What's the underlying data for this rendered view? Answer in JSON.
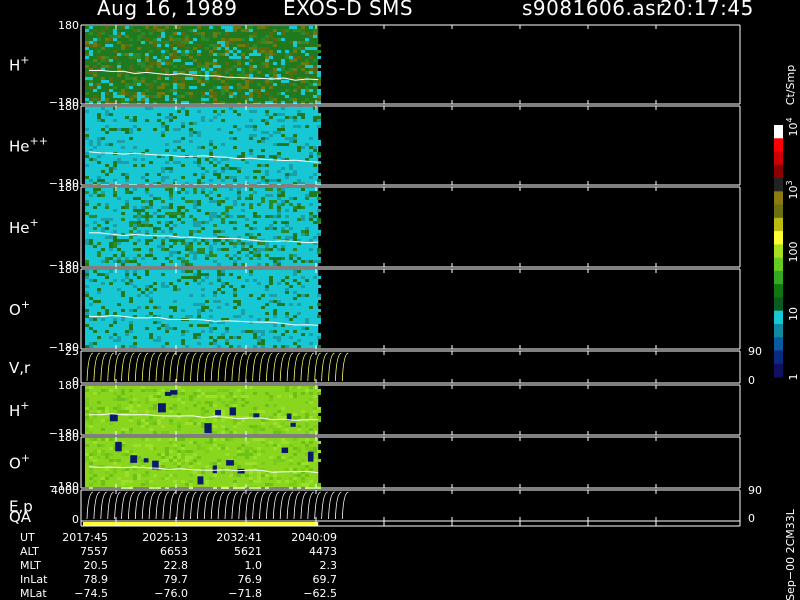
{
  "header": {
    "date": "Aug 16, 1989",
    "mission": "EXOS-D SMS",
    "file": "s9081606.asr",
    "time": "20:17:45"
  },
  "colors": {
    "background": "#000000",
    "axis": "#ffffff",
    "trace": "#ffffff",
    "energy_trace": "#ffff66",
    "qa_bar": "#ffff33",
    "cyan": "#17c8d4",
    "dark_green": "#1f7a1f",
    "olive": "#6d7a12",
    "lime": "#8ad61f",
    "navy": "#0a1a6a"
  },
  "colorbar": {
    "title": "Ct/Smp",
    "scale": "log",
    "range": [
      1,
      10000
    ],
    "tick_labels": [
      {
        "base": "10",
        "exp": "4",
        "value": 10000
      },
      {
        "base": "10",
        "exp": "3",
        "value": 1000
      },
      {
        "base": "100",
        "exp": "",
        "value": 100
      },
      {
        "base": "10",
        "exp": "",
        "value": 10
      },
      {
        "base": "1",
        "exp": "",
        "value": 1
      }
    ],
    "swatches": [
      "#ffffff",
      "#ff0000",
      "#cc0000",
      "#880000",
      "#222222",
      "#8a7a10",
      "#6d7010",
      "#bbbb10",
      "#ffff33",
      "#a8e020",
      "#66cc22",
      "#33aa22",
      "#117711",
      "#0a5a22",
      "#17c8d4",
      "#108aa0",
      "#0a5aa0",
      "#0a2a80",
      "#101060"
    ]
  },
  "panels": [
    {
      "id": "h_plus",
      "label": "H",
      "sup": "+",
      "ymax": "180",
      "ymin": "−180",
      "kind": "spectro",
      "palette": [
        "#1f7a1f",
        "#2a8a2a",
        "#6d7a12",
        "#17c8d4",
        "#5a6a10"
      ]
    },
    {
      "id": "he_pp",
      "label": "He",
      "sup": "++",
      "ymax": "180",
      "ymin": "−180",
      "kind": "spectro",
      "palette": [
        "#17c8d4",
        "#17c8d4",
        "#1aa0a8",
        "#1f7a1f",
        "#17c8d4"
      ]
    },
    {
      "id": "he_plus",
      "label": "He",
      "sup": "+",
      "ymax": "180",
      "ymin": "−180",
      "kind": "spectro",
      "palette": [
        "#17c8d4",
        "#1f7a1f",
        "#17c8d4",
        "#2a8a2a",
        "#1aa0a8"
      ]
    },
    {
      "id": "o_plus",
      "label": "O",
      "sup": "+",
      "ymax": "180",
      "ymin": "−180",
      "kind": "spectro",
      "palette": [
        "#17c8d4",
        "#17c8d4",
        "#1f7a1f",
        "#1aa0a8",
        "#17c8d4"
      ]
    },
    {
      "id": "vr",
      "label": "V,r",
      "sup": "",
      "ymax": "25",
      "ymin": "0",
      "kind": "trace",
      "rmax": "90",
      "rmin": "0"
    },
    {
      "id": "h_plus2",
      "label": "H",
      "sup": "+",
      "ymax": "180",
      "ymin": "−180",
      "kind": "spectro",
      "palette": [
        "#8ad61f",
        "#8ad61f",
        "#7acc1a",
        "#9be02a",
        "#6dc018"
      ]
    },
    {
      "id": "o_plus2",
      "label": "O",
      "sup": "+",
      "ymax": "180",
      "ymin": "−180",
      "kind": "spectro",
      "palette": [
        "#8ad61f",
        "#8ad61f",
        "#7acc1a",
        "#9be02a",
        "#6dc018"
      ]
    },
    {
      "id": "ep",
      "label": "E,p",
      "sup": "",
      "ymax": "4000",
      "ymin": "0",
      "kind": "trace",
      "rmax": "90",
      "rmin": "0"
    },
    {
      "id": "qa",
      "label": "QA",
      "sup": "",
      "ymax": "",
      "ymin": "",
      "kind": "qa"
    }
  ],
  "ephemeris": {
    "rows": [
      {
        "name": "UT",
        "values": [
          "2017:45",
          "2025:13",
          "2032:41",
          "2040:09"
        ]
      },
      {
        "name": "ALT",
        "values": [
          "7557",
          "6653",
          "5621",
          "4473"
        ]
      },
      {
        "name": "MLT",
        "values": [
          "20.5",
          "22.8",
          "1.0",
          "2.3"
        ]
      },
      {
        "name": "InLat",
        "values": [
          "78.9",
          "79.7",
          "76.9",
          "69.7"
        ]
      },
      {
        "name": "MLat",
        "values": [
          "−74.5",
          "−76.0",
          "−71.8",
          "−62.5"
        ]
      }
    ]
  },
  "footer_side": "Sep−00  2CM33L",
  "chart_data": {
    "type": "heatmap",
    "title": "Aug 16, 1989   EXOS-D SMS",
    "subtitle": "s9081606.asr  20:17:45",
    "x_ticks": [
      "2017:45",
      "2025:13",
      "2032:41",
      "2040:09"
    ],
    "data_coverage_fraction": 0.36,
    "series": [
      {
        "name": "H+",
        "y_range": [
          -180,
          180
        ]
      },
      {
        "name": "He++",
        "y_range": [
          -180,
          180
        ]
      },
      {
        "name": "He+",
        "y_range": [
          -180,
          180
        ]
      },
      {
        "name": "O+",
        "y_range": [
          -180,
          180
        ]
      },
      {
        "name": "V,r",
        "y_range": [
          0,
          25
        ],
        "right_range": [
          0,
          90
        ]
      },
      {
        "name": "H+",
        "y_range": [
          -180,
          180
        ]
      },
      {
        "name": "O+",
        "y_range": [
          -180,
          180
        ]
      },
      {
        "name": "E,p",
        "y_range": [
          0,
          4000
        ],
        "right_range": [
          0,
          90
        ]
      },
      {
        "name": "QA"
      }
    ]
  }
}
